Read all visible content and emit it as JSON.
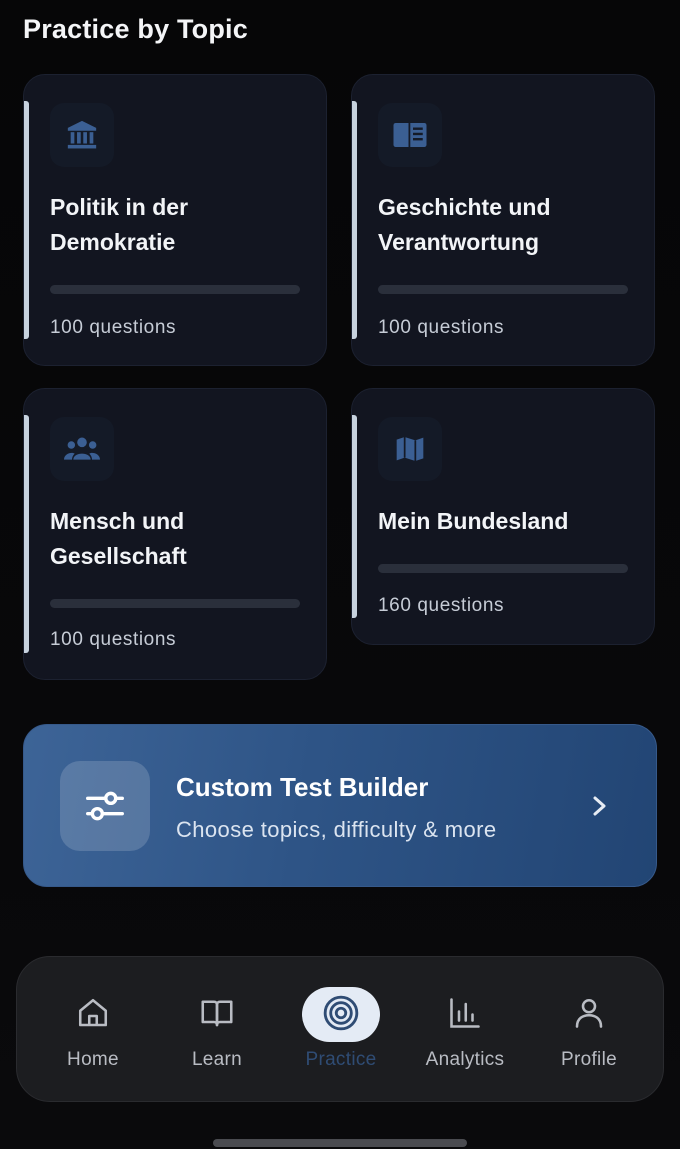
{
  "section_title": "Practice by Topic",
  "topics": [
    {
      "title": "Politik in der Demokratie",
      "count_label": "100 questions",
      "progress": 0,
      "icon": "building-columns-icon"
    },
    {
      "title": "Geschichte und Verantwortung",
      "count_label": "100 questions",
      "progress": 0,
      "icon": "book-icon"
    },
    {
      "title": "Mensch und Gesellschaft",
      "count_label": "100 questions",
      "progress": 0,
      "icon": "people-group-icon"
    },
    {
      "title": "Mein Bundesland",
      "count_label": "160 questions",
      "progress": 0,
      "icon": "map-icon"
    }
  ],
  "custom_test": {
    "title": "Custom Test Builder",
    "subtitle": "Choose topics, difficulty & more",
    "icon": "sliders-icon"
  },
  "nav": {
    "items": [
      {
        "label": "Home",
        "icon": "home-icon"
      },
      {
        "label": "Learn",
        "icon": "book-open-icon"
      },
      {
        "label": "Practice",
        "icon": "target-icon",
        "active": true
      },
      {
        "label": "Analytics",
        "icon": "bar-chart-icon"
      },
      {
        "label": "Profile",
        "icon": "user-icon"
      }
    ]
  },
  "colors": {
    "accent": "#2f4c74",
    "card_bg": "#121520",
    "banner_start": "#3d6497",
    "banner_end": "#224574"
  }
}
